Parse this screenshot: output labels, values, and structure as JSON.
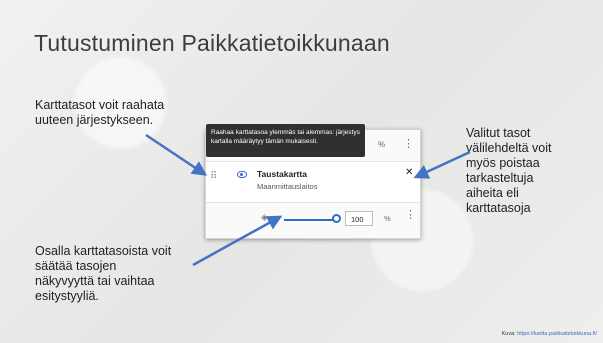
{
  "slide": {
    "title": "Tutustuminen Paikkatietoikkunaan",
    "note_top_left": "Karttatasot voit raahata\nuuteen järjestykseen.",
    "note_right": "Valitut tasot\nvälilehdeltä voit\nmyös poistaa\ntarkasteltuja\naiheita eli\nkarttatasoja",
    "note_bottom_left": "Osalla karttatasoista voit\nsäätää tasojen\nnäkyvyyttä tai vaihtaa\nesitystyyliä.",
    "credit_label": "Kuva:",
    "credit_link": "https://kartta.paikkatietoikkuna.fi/"
  },
  "panel": {
    "tooltip": "Raahaa karttatasoa ylemmäs tai alemmas: järjestys kartalla määräytyy tämän mukaisesti.",
    "top_percent_label": "%",
    "layer": {
      "name": "Taustakartta",
      "source": "Maanmittauslaitos",
      "opacity_value": "100",
      "percent_label": "%"
    },
    "icons": {
      "drag": "drag-handle-icon",
      "visibility": "eye-icon",
      "remove": "close-icon",
      "style": "layers-icon",
      "menu": "kebab-menu-icon"
    },
    "accent_color": "#2e6bc6",
    "opacity_level_percent": 100
  }
}
